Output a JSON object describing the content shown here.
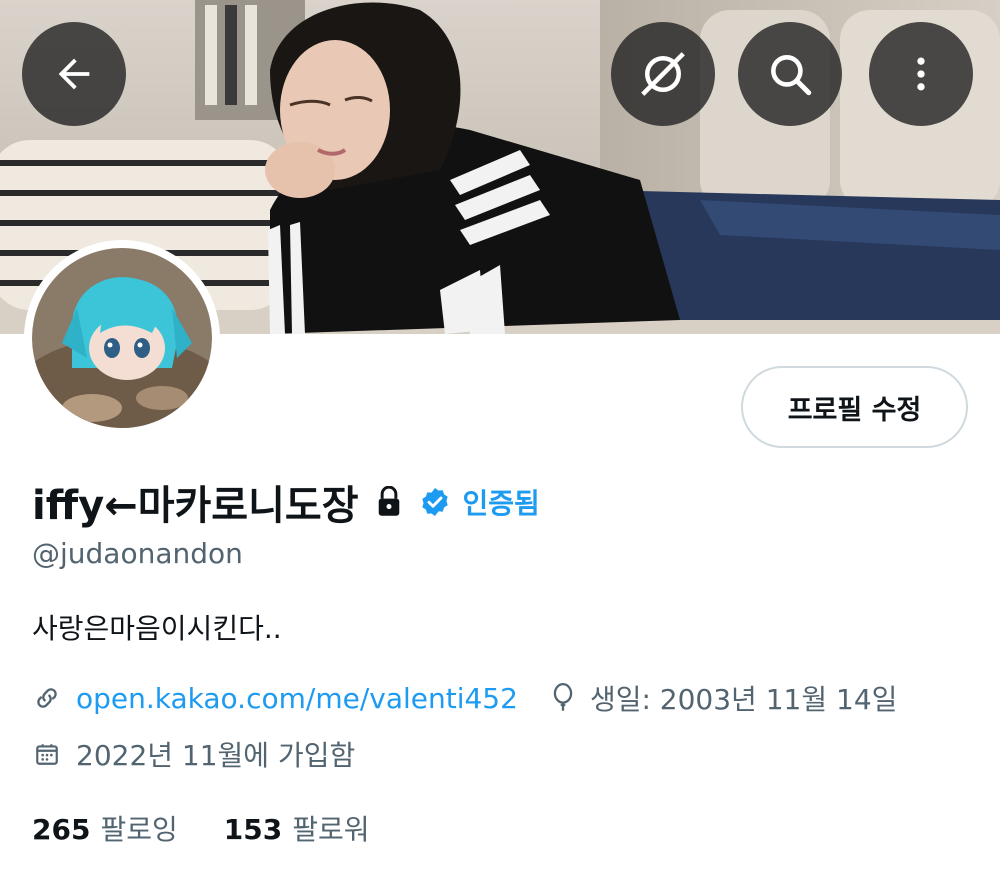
{
  "header": {
    "back_icon": "arrow-left-icon",
    "hide_icon": "eye-slash-icon",
    "search_icon": "search-icon",
    "more_icon": "more-vertical-icon"
  },
  "profile": {
    "edit_button": "프로필 수정",
    "display_name": "iffy←마카로니도장",
    "verified_label": "인증됨",
    "handle": "@judaonandon",
    "bio": "사랑은마음이시킨다..",
    "link": "open.kakao.com/me/valenti452",
    "birthday": "생일: 2003년 11월 14일",
    "joined": "2022년 11월에 가입함"
  },
  "stats": {
    "following_count": "265",
    "following_label": "팔로잉",
    "followers_count": "153",
    "followers_label": "팔로워"
  },
  "colors": {
    "accent": "#1d9bf0",
    "secondary_text": "#536471",
    "primary_text": "#0f1419",
    "border": "#cfd9de"
  }
}
